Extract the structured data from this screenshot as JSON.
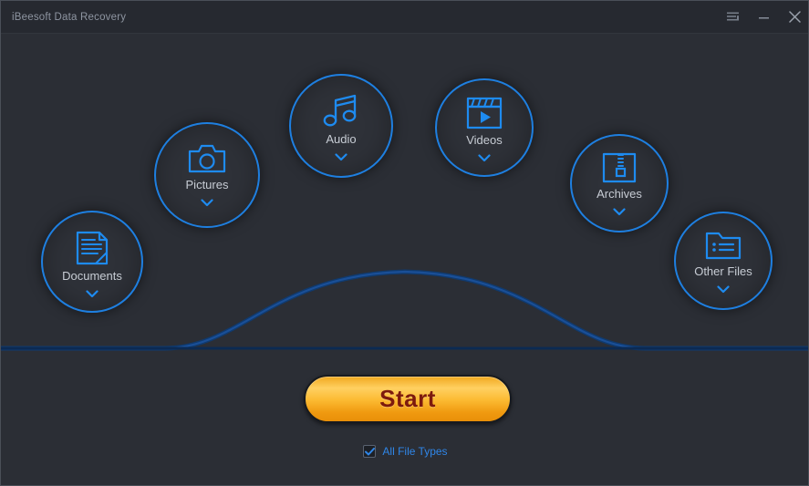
{
  "window": {
    "title": "iBeesoft Data Recovery",
    "background_color": "#2b2e35",
    "titlebar_color": "#262930",
    "accent_color": "#1e7fe0"
  },
  "titlebar": {
    "menu_icon": "hamburger-menu-icon",
    "minimize_icon": "minimize-icon",
    "close_icon": "close-icon"
  },
  "categories": [
    {
      "id": "documents",
      "label": "Documents",
      "icon": "document-icon",
      "selected": true,
      "chevron": "chevron-down-icon"
    },
    {
      "id": "pictures",
      "label": "Pictures",
      "icon": "camera-icon",
      "selected": true,
      "chevron": "chevron-down-icon"
    },
    {
      "id": "audio",
      "label": "Audio",
      "icon": "music-note-icon",
      "selected": true,
      "chevron": "chevron-down-icon"
    },
    {
      "id": "videos",
      "label": "Videos",
      "icon": "clapperboard-play-icon",
      "selected": true,
      "chevron": "chevron-down-icon"
    },
    {
      "id": "archives",
      "label": "Archives",
      "icon": "zip-archive-icon",
      "selected": true,
      "chevron": "chevron-down-icon"
    },
    {
      "id": "otherfiles",
      "label": "Other Files",
      "icon": "folder-list-icon",
      "selected": true,
      "chevron": "chevron-down-icon"
    }
  ],
  "start": {
    "label": "Start",
    "button_color": "#fcbb33",
    "text_color": "#7d1a0d"
  },
  "options": {
    "all_file_types_label": "All File Types",
    "all_file_types_checked": true,
    "checkmark_icon": "checkmark-icon",
    "link_color": "#2f86e8"
  },
  "footer": {
    "hint": ""
  }
}
